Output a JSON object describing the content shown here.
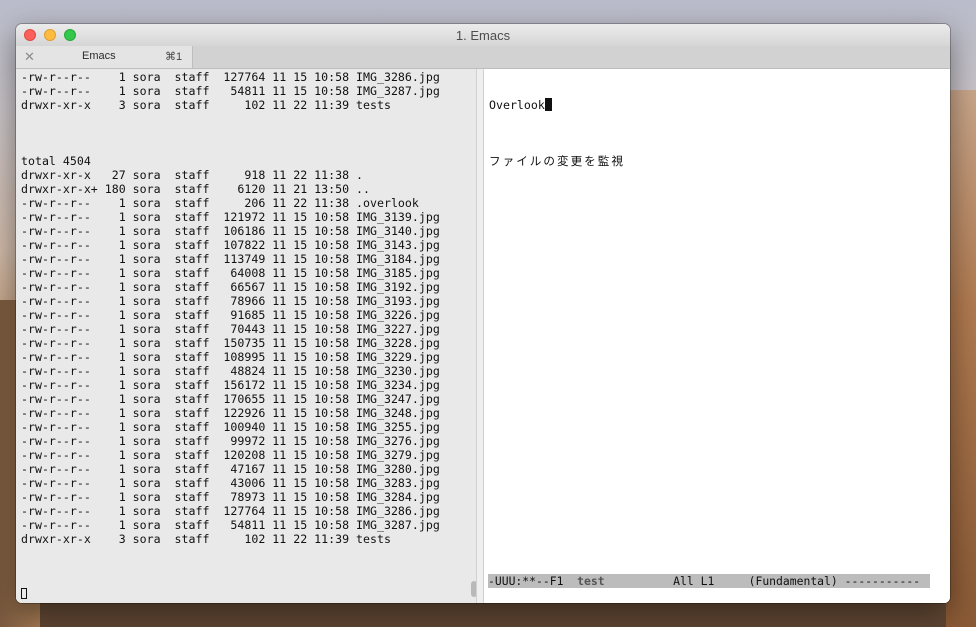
{
  "window": {
    "title": "1. Emacs"
  },
  "tab": {
    "label": "Emacs",
    "shortcut": "⌘1",
    "close": "✕"
  },
  "left_terminal": {
    "lines": [
      "-rw-r--r--    1 sora  staff  127764 11 15 10:58 IMG_3286.jpg",
      "-rw-r--r--    1 sora  staff   54811 11 15 10:58 IMG_3287.jpg",
      "drwxr-xr-x    3 sora  staff     102 11 22 11:39 tests",
      "",
      "",
      "",
      "total 4504",
      "drwxr-xr-x   27 sora  staff     918 11 22 11:38 .",
      "drwxr-xr-x+ 180 sora  staff    6120 11 21 13:50 ..",
      "-rw-r--r--    1 sora  staff     206 11 22 11:38 .overlook",
      "-rw-r--r--    1 sora  staff  121972 11 15 10:58 IMG_3139.jpg",
      "-rw-r--r--    1 sora  staff  106186 11 15 10:58 IMG_3140.jpg",
      "-rw-r--r--    1 sora  staff  107822 11 15 10:58 IMG_3143.jpg",
      "-rw-r--r--    1 sora  staff  113749 11 15 10:58 IMG_3184.jpg",
      "-rw-r--r--    1 sora  staff   64008 11 15 10:58 IMG_3185.jpg",
      "-rw-r--r--    1 sora  staff   66567 11 15 10:58 IMG_3192.jpg",
      "-rw-r--r--    1 sora  staff   78966 11 15 10:58 IMG_3193.jpg",
      "-rw-r--r--    1 sora  staff   91685 11 15 10:58 IMG_3226.jpg",
      "-rw-r--r--    1 sora  staff   70443 11 15 10:58 IMG_3227.jpg",
      "-rw-r--r--    1 sora  staff  150735 11 15 10:58 IMG_3228.jpg",
      "-rw-r--r--    1 sora  staff  108995 11 15 10:58 IMG_3229.jpg",
      "-rw-r--r--    1 sora  staff   48824 11 15 10:58 IMG_3230.jpg",
      "-rw-r--r--    1 sora  staff  156172 11 15 10:58 IMG_3234.jpg",
      "-rw-r--r--    1 sora  staff  170655 11 15 10:58 IMG_3247.jpg",
      "-rw-r--r--    1 sora  staff  122926 11 15 10:58 IMG_3248.jpg",
      "-rw-r--r--    1 sora  staff  100940 11 15 10:58 IMG_3255.jpg",
      "-rw-r--r--    1 sora  staff   99972 11 15 10:58 IMG_3276.jpg",
      "-rw-r--r--    1 sora  staff  120208 11 15 10:58 IMG_3279.jpg",
      "-rw-r--r--    1 sora  staff   47167 11 15 10:58 IMG_3280.jpg",
      "-rw-r--r--    1 sora  staff   43006 11 15 10:58 IMG_3283.jpg",
      "-rw-r--r--    1 sora  staff   78973 11 15 10:58 IMG_3284.jpg",
      "-rw-r--r--    1 sora  staff  127764 11 15 10:58 IMG_3286.jpg",
      "-rw-r--r--    1 sora  staff   54811 11 15 10:58 IMG_3287.jpg",
      "drwxr-xr-x    3 sora  staff     102 11 22 11:39 tests"
    ]
  },
  "emacs": {
    "line1": "Overlook",
    "line2": "ファイルの変更を監視",
    "modeline_status": "-UUU:**--F1  ",
    "modeline_buffer": "test",
    "modeline_rest": "          All L1     (Fundamental) -----------"
  }
}
